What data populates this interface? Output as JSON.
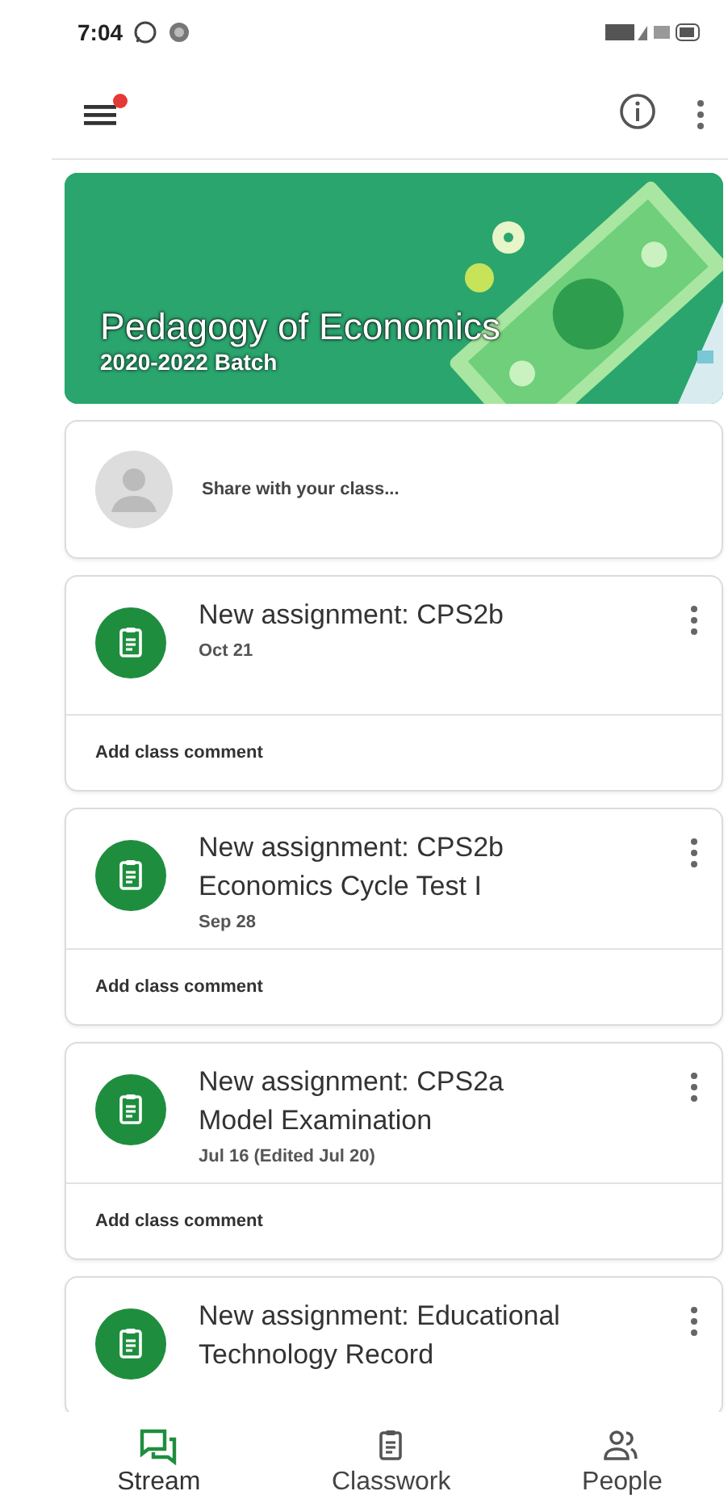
{
  "status_bar": {
    "time": "7:04"
  },
  "class_banner": {
    "title": "Pedagogy of Economics",
    "subtitle": "2020-2022 Batch"
  },
  "share_box": {
    "placeholder": "Share with your class..."
  },
  "posts": [
    {
      "title_lines": [
        "New assignment: CPS2b"
      ],
      "date": "Oct 21",
      "comment_placeholder": "Add class comment"
    },
    {
      "title_lines": [
        "New assignment: CPS2b",
        "Economics Cycle Test I"
      ],
      "date": "Sep 28",
      "comment_placeholder": "Add class comment"
    },
    {
      "title_lines": [
        "New assignment: CPS2a",
        "Model Examination"
      ],
      "date": "Jul 16 (Edited Jul 20)",
      "comment_placeholder": "Add class comment"
    },
    {
      "title_lines": [
        "New assignment: Educational",
        "Technology Record"
      ]
    }
  ],
  "bottom_nav": [
    {
      "label": "Stream",
      "selected": true,
      "kind": "stream"
    },
    {
      "label": "Classwork",
      "selected": false,
      "kind": "classwork"
    },
    {
      "label": "People",
      "selected": false,
      "kind": "people"
    }
  ]
}
